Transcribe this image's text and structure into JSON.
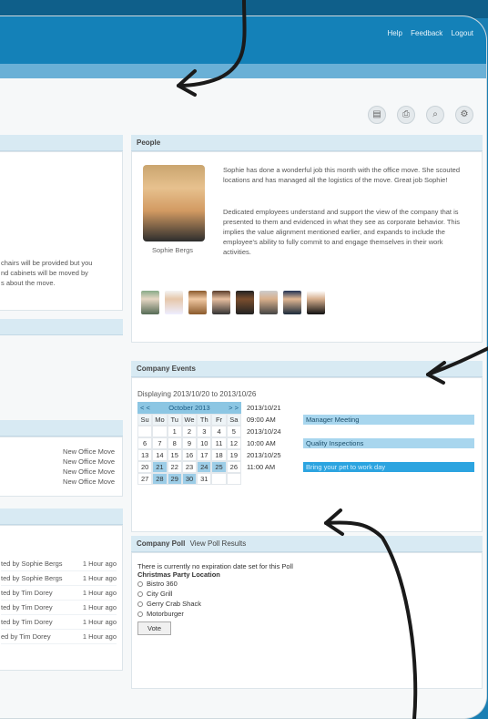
{
  "top_links": [
    "Help",
    "Feedback",
    "Logout"
  ],
  "people": {
    "title": "People",
    "name": "Sophie Bergs",
    "paragraph1": "Sophie has done a wonderful job this month with the office move. She scouted locations and has managed all the logistics of the move. Great job Sophie!",
    "paragraph2": "Dedicated employees understand and support the view of the company that is presented to them and evidenced in what they see as corporate behavior. This implies the value alignment mentioned earlier, and expands to include the employee's ability to fully commit to and engage themselves in their work activities."
  },
  "left_text": {
    "line1": "chairs will be provided but you",
    "line2": "nd cabinets will be moved by",
    "line3": "s about the move."
  },
  "left_moves": [
    "New Office Move",
    "New Office Move",
    "New Office Move",
    "New Office Move"
  ],
  "left_activity": [
    {
      "by": "ted by Sophie Bergs",
      "time": "1 Hour ago"
    },
    {
      "by": "ted by Sophie Bergs",
      "time": "1 Hour ago"
    },
    {
      "by": "ted by Tim Dorey",
      "time": "1 Hour ago"
    },
    {
      "by": "ted by Tim Dorey",
      "time": "1 Hour ago"
    },
    {
      "by": "ted by Tim Dorey",
      "time": "1 Hour ago"
    },
    {
      "by": "ed by Tim Dorey",
      "time": "1 Hour ago"
    }
  ],
  "events": {
    "title": "Company Events",
    "range_label": "Displaying  2013/10/20  to  2013/10/26",
    "calendar": {
      "prev": "< <",
      "month": "October 2013",
      "next": "> >",
      "days": [
        "Su",
        "Mo",
        "Tu",
        "We",
        "Th",
        "Fr",
        "Sa"
      ],
      "rows": [
        [
          "",
          "",
          "1",
          "2",
          "3",
          "4",
          "5"
        ],
        [
          "6",
          "7",
          "8",
          "9",
          "10",
          "11",
          "12"
        ],
        [
          "13",
          "14",
          "15",
          "16",
          "17",
          "18",
          "19"
        ],
        [
          "20",
          "21",
          "22",
          "23",
          "24",
          "25",
          "26"
        ],
        [
          "27",
          "28",
          "29",
          "30",
          "31",
          "",
          ""
        ]
      ]
    },
    "list": [
      {
        "date": "2013/10/21",
        "time": "09:00 AM",
        "title": "Manager Meeting"
      },
      {
        "date": "2013/10/24",
        "time": "10:00 AM",
        "title": "Quality Inspections"
      },
      {
        "date": "2013/10/25",
        "time": "11:00 AM",
        "title": "Bring your pet to work day"
      }
    ]
  },
  "poll": {
    "title": "Company Poll",
    "view_link": "View Poll Results",
    "note": "There is currently no expiration date set for this Poll",
    "question": "Christmas Party Location",
    "options": [
      "Bistro 360",
      "City Grill",
      "Gerry Crab Shack",
      "Motorburger"
    ],
    "vote_label": "Vote"
  }
}
